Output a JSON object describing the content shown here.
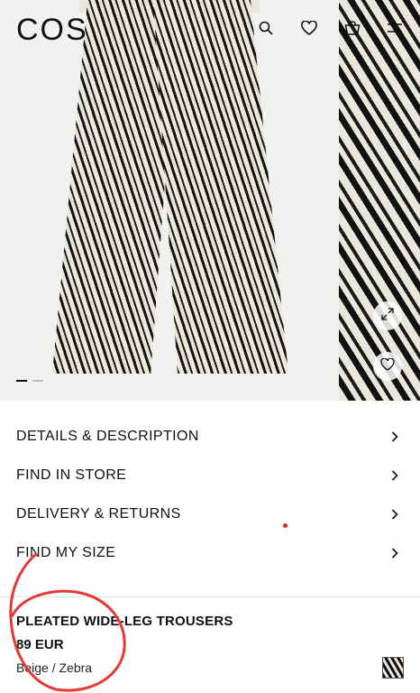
{
  "header": {
    "logo": "COS",
    "icons": [
      "search-icon",
      "heart-icon",
      "bag-icon",
      "menu-icon"
    ]
  },
  "gallery": {
    "slide_count": 2,
    "active_slide": 1
  },
  "menu": {
    "items": [
      {
        "label": "DETAILS & DESCRIPTION"
      },
      {
        "label": "FIND IN STORE"
      },
      {
        "label": "DELIVERY & RETURNS"
      },
      {
        "label": "FIND MY SIZE"
      }
    ]
  },
  "product": {
    "title": "PLEATED WIDE-LEG TROUSERS",
    "price": "89 EUR",
    "color": "Beige / Zebra"
  },
  "colors": {
    "annotation": "#e53935",
    "text": "#111111"
  }
}
